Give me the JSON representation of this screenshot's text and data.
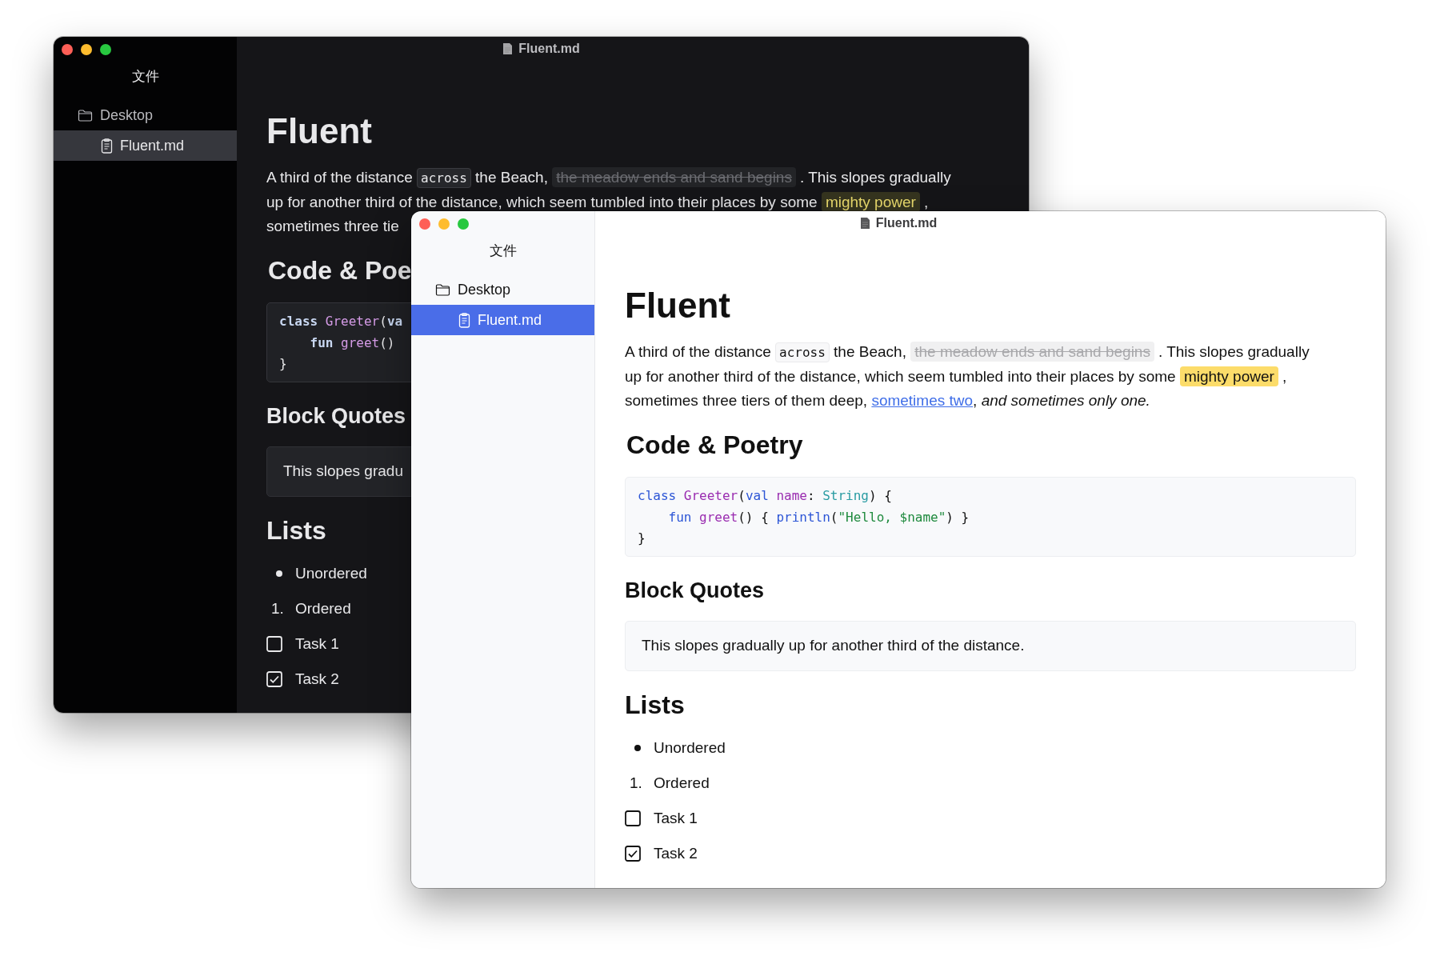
{
  "windows": [
    {
      "kind": "dark",
      "title": "Fluent.md",
      "sidebar": {
        "header": "文件",
        "items": [
          {
            "label": "Desktop",
            "kind": "folder",
            "selected": false,
            "children": [
              {
                "label": "Fluent.md",
                "kind": "file",
                "selected": true
              }
            ]
          }
        ]
      },
      "heading": "Fluent",
      "paragraph": [
        [
          {
            "kind": "text",
            "text": "A third of the distance "
          },
          {
            "kind": "code",
            "text": "across"
          },
          {
            "kind": "text",
            "text": " the Beach, "
          },
          {
            "kind": "strike",
            "text": "the meadow ends and sand begins"
          },
          {
            "kind": "text",
            "text": ". This slopes gradually"
          }
        ],
        [
          {
            "kind": "text",
            "text": "up for another third of the distance, which seem tumbled into their places by some "
          },
          {
            "kind": "mark",
            "text": "mighty power"
          },
          {
            "kind": "text",
            "text": ","
          }
        ],
        [
          {
            "kind": "text",
            "text": "sometimes three tie"
          }
        ]
      ],
      "code_heading": "Code & Poe",
      "code": [
        [
          {
            "kind": "keyword",
            "text": "class "
          },
          {
            "kind": "name",
            "text": "Greeter"
          },
          {
            "kind": "plain",
            "text": "("
          },
          {
            "kind": "keyword",
            "text": "va"
          }
        ],
        [
          {
            "kind": "keyword",
            "text": "    fun "
          },
          {
            "kind": "name",
            "text": "greet"
          },
          {
            "kind": "plain",
            "text": "()"
          }
        ],
        [
          {
            "kind": "plain",
            "text": "}"
          }
        ]
      ],
      "quote_heading": "Block Quotes",
      "quote": "This slopes gradu",
      "list_heading": "Lists",
      "list": [
        {
          "kind": "bullet",
          "label": "Unordered"
        },
        {
          "kind": "ordered",
          "marker": "1.",
          "label": "Ordered"
        },
        {
          "kind": "task",
          "checked": false,
          "label": "Task 1"
        },
        {
          "kind": "task",
          "checked": true,
          "label": "Task 2"
        }
      ]
    },
    {
      "kind": "light",
      "title": "Fluent.md",
      "sidebar": {
        "header": "文件",
        "items": [
          {
            "label": "Desktop",
            "kind": "folder",
            "selected": false,
            "children": [
              {
                "label": "Fluent.md",
                "kind": "file",
                "selected": true
              }
            ]
          }
        ]
      },
      "heading": "Fluent",
      "paragraph": [
        [
          {
            "kind": "text",
            "text": "A third of the distance "
          },
          {
            "kind": "code",
            "text": "across"
          },
          {
            "kind": "text",
            "text": " the Beach, "
          },
          {
            "kind": "strike",
            "text": "the meadow ends and sand begins"
          },
          {
            "kind": "text",
            "text": ". This slopes gradually"
          }
        ],
        [
          {
            "kind": "text",
            "text": "up for another third of the distance, which seem tumbled into their places by some "
          },
          {
            "kind": "mark",
            "text": "mighty power"
          },
          {
            "kind": "text",
            "text": ","
          }
        ],
        [
          {
            "kind": "text",
            "text": "sometimes three tiers of them deep, "
          },
          {
            "kind": "link",
            "text": "sometimes two"
          },
          {
            "kind": "text",
            "text": ", "
          },
          {
            "kind": "italic",
            "text": "and sometimes only one."
          }
        ]
      ],
      "code_heading": "Code & Poetry",
      "code": [
        [
          {
            "kind": "keyword",
            "text": "class "
          },
          {
            "kind": "name",
            "text": "Greeter"
          },
          {
            "kind": "plain",
            "text": "("
          },
          {
            "kind": "keyword",
            "text": "val "
          },
          {
            "kind": "name",
            "text": "name"
          },
          {
            "kind": "plain",
            "text": ": "
          },
          {
            "kind": "type",
            "text": "String"
          },
          {
            "kind": "plain",
            "text": ") {"
          }
        ],
        [
          {
            "kind": "keyword",
            "text": "    fun "
          },
          {
            "kind": "name",
            "text": "greet"
          },
          {
            "kind": "plain",
            "text": "() { "
          },
          {
            "kind": "keyword",
            "text": "println"
          },
          {
            "kind": "plain",
            "text": "("
          },
          {
            "kind": "string",
            "text": "\"Hello, $name\""
          },
          {
            "kind": "plain",
            "text": ") }"
          }
        ],
        [
          {
            "kind": "plain",
            "text": "}"
          }
        ]
      ],
      "quote_heading": "Block Quotes",
      "quote": "This slopes gradually up for another third of the distance.",
      "list_heading": "Lists",
      "list": [
        {
          "kind": "bullet",
          "label": "Unordered"
        },
        {
          "kind": "ordered",
          "marker": "1.",
          "label": "Ordered"
        },
        {
          "kind": "task",
          "checked": false,
          "label": "Task 1"
        },
        {
          "kind": "task",
          "checked": true,
          "label": "Task 2"
        }
      ]
    }
  ]
}
